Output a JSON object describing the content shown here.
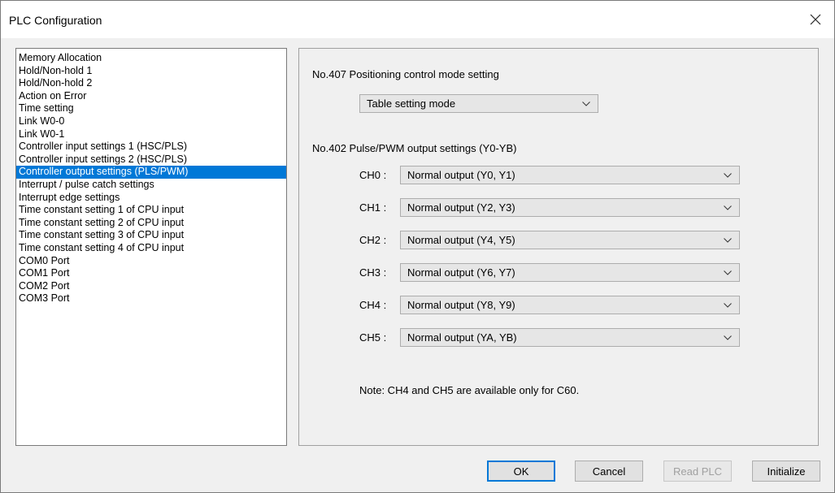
{
  "window": {
    "title": "PLC Configuration"
  },
  "list": {
    "items": [
      "Memory Allocation",
      "Hold/Non-hold 1",
      "Hold/Non-hold 2",
      "Action on Error",
      "Time setting",
      "Link W0-0",
      "Link W0-1",
      "Controller input settings 1 (HSC/PLS)",
      "Controller input settings 2 (HSC/PLS)",
      "Controller output settings (PLS/PWM)",
      "Interrupt / pulse catch settings",
      "Interrupt edge settings",
      "Time constant setting 1 of CPU input",
      "Time constant setting 2 of CPU input",
      "Time constant setting 3 of CPU input",
      "Time constant setting 4 of CPU input",
      "COM0 Port",
      "COM1 Port",
      "COM2 Port",
      "COM3 Port"
    ],
    "selected": "Controller output settings (PLS/PWM)"
  },
  "panel": {
    "positioning_label": "No.407 Positioning control mode setting",
    "positioning_value": "Table setting mode",
    "pulse_label": "No.402 Pulse/PWM output settings (Y0-YB)",
    "channels": [
      {
        "label": "CH0 :",
        "value": "Normal output (Y0, Y1)"
      },
      {
        "label": "CH1 :",
        "value": "Normal output (Y2, Y3)"
      },
      {
        "label": "CH2 :",
        "value": "Normal output (Y4, Y5)"
      },
      {
        "label": "CH3 :",
        "value": "Normal output (Y6, Y7)"
      },
      {
        "label": "CH4 :",
        "value": "Normal output (Y8, Y9)"
      },
      {
        "label": "CH5 :",
        "value": "Normal output (YA, YB)"
      }
    ],
    "note": "Note: CH4 and CH5 are available only for C60."
  },
  "buttons": {
    "ok": "OK",
    "cancel": "Cancel",
    "read_plc": "Read PLC",
    "initialize": "Initialize"
  },
  "colors": {
    "selection": "#0078d7",
    "default_button_border": "#0078d7"
  }
}
